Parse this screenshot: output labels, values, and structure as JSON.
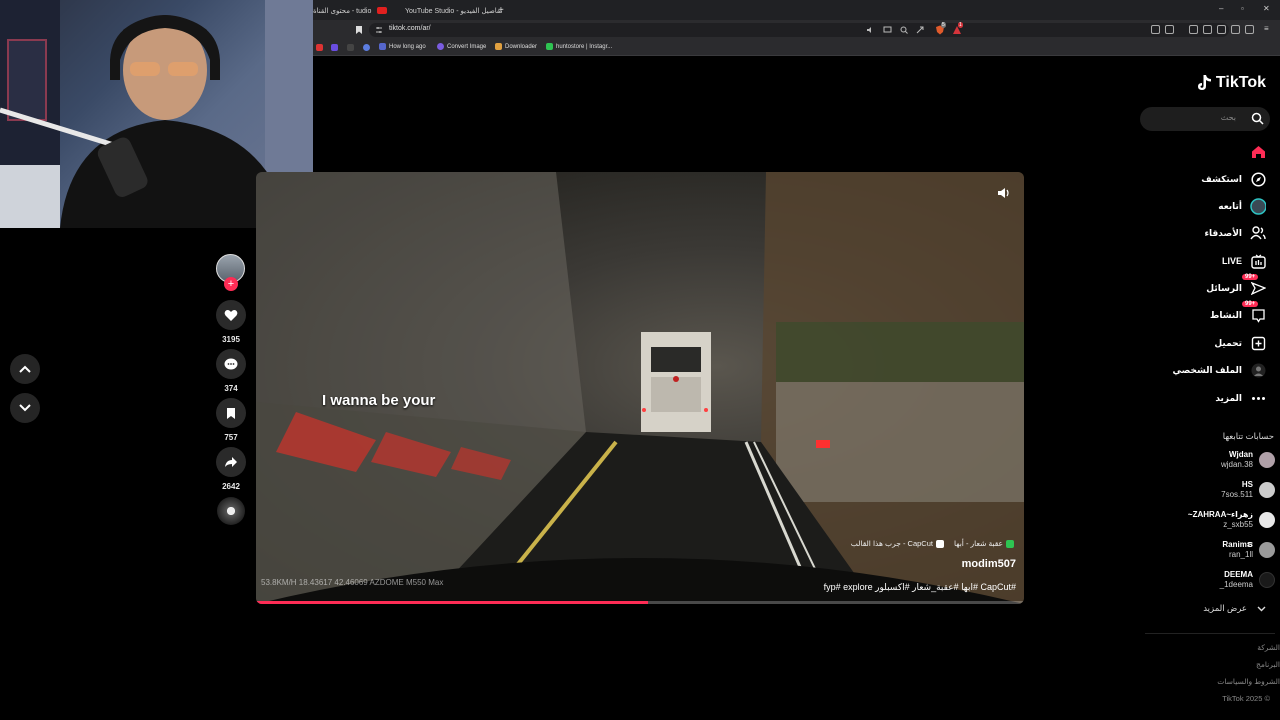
{
  "browser": {
    "tabs": [
      {
        "label": "محتوى القناة - tudio"
      },
      {
        "label": "YouTube Studio - تفاصيل الفيديو"
      }
    ],
    "url": "tiktok.com/ar/",
    "bookmarks": [
      {
        "label": "How long ago"
      },
      {
        "label": "Convert Image"
      },
      {
        "label": "Downloader"
      },
      {
        "label": "huntostore | Instagr..."
      }
    ],
    "shield_badge": "5",
    "alert_badge": "1"
  },
  "video": {
    "caption": "I wanna be your",
    "author": "modim507",
    "description": "#CapCut #ابها #عقبة_شعار #اكسبلور fyp# explore",
    "effect": "CapCut - جرب هذا القالب",
    "location": "عقبة شعار - أبها",
    "hud": "53.8KM/H  18.43617  42.46069  AZDOME M550 Max",
    "progress": 0.51
  },
  "actions": {
    "likes": "3195",
    "comments": "374",
    "saves": "757",
    "shares": "2642"
  },
  "sidebar": {
    "logo": "TikTok",
    "search_placeholder": "بحث",
    "nav": [
      {
        "label": ""
      },
      {
        "label": "استكشف"
      },
      {
        "label": "أتابعه"
      },
      {
        "label": "الأصدقاء"
      },
      {
        "label": "LIVE"
      },
      {
        "label": "الرسائل",
        "badge": "99+"
      },
      {
        "label": "النشاط",
        "badge": "99+"
      },
      {
        "label": "تحميل"
      },
      {
        "label": "الملف الشخصي"
      },
      {
        "label": "المزيد"
      }
    ],
    "following_title": "حسابات تتابعها",
    "accounts": [
      {
        "name": "Wjdan",
        "user": "wjdan.38"
      },
      {
        "name": "HS",
        "user": "7sos.511"
      },
      {
        "name": "~ZAHRAA~زهراء",
        "user": "z_sxb55"
      },
      {
        "name": "Ranimຣ",
        "user": "ran_1ll"
      },
      {
        "name": "DEEMA",
        "user": "_1deema"
      }
    ],
    "see_more": "عرض المزيد",
    "footer": [
      "الشركة",
      "البرنامج",
      "الشروط والسياسات",
      "© 2025 TikTok"
    ]
  },
  "colors": {
    "accent": "#fe2c55",
    "background": "#000000",
    "sidebar_text": "#ffffff"
  }
}
